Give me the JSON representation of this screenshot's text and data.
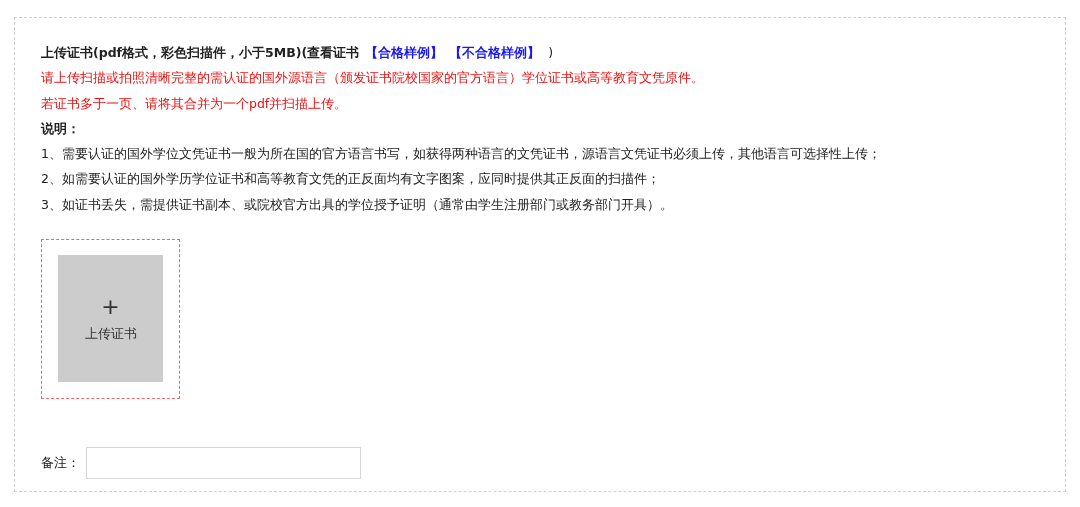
{
  "header": {
    "title": "上传证书(pdf格式，彩色扫描件，小于5MB)(查看证书",
    "links": [
      "【合格样例】",
      "【不合格样例】"
    ],
    "close": ")"
  },
  "warnings": [
    "请上传扫描或拍照清晰完整的需认证的国外源语言（颁发证书院校国家的官方语言）学位证书或高等教育文凭原件。",
    "若证书多于一页、请将其合并为一个pdf并扫描上传。"
  ],
  "explanation": {
    "heading": "说明：",
    "items": [
      "1、需要认证的国外学位文凭证书一般为所在国的官方语言书写，如获得两种语言的文凭证书，源语言文凭证书必须上传，其他语言可选择性上传；",
      "2、如需要认证的国外学历学位证书和高等教育文凭的正反面均有文字图案，应同时提供其正反面的扫描件；",
      "3、如证书丢失，需提供证书副本、或院校官方出具的学位授予证明（通常由学生注册部门或教务部门开具）。"
    ]
  },
  "upload": {
    "icon": "+",
    "label": "上传证书"
  },
  "remark": {
    "label": "备注："
  }
}
